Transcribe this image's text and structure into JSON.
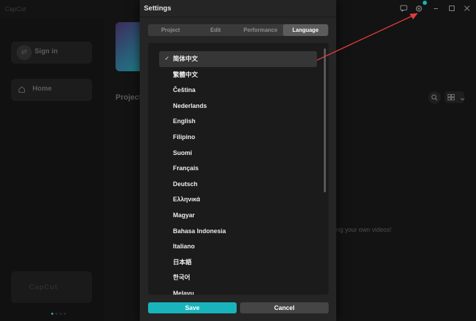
{
  "app": {
    "logo_text": "CapCut",
    "sidebar": {
      "sign_in_label": "Sign in",
      "home_label": "Home",
      "promo_text": "CapCut"
    },
    "main": {
      "projects_title": "Projects",
      "empty_hint": "ng your own videos!"
    }
  },
  "window_controls": [
    "feedback-icon",
    "settings-icon",
    "minimize-icon",
    "maximize-icon",
    "close-icon"
  ],
  "settings": {
    "title": "Settings",
    "tabs": [
      {
        "label": "Project"
      },
      {
        "label": "Edit"
      },
      {
        "label": "Performance"
      },
      {
        "label": "Language",
        "active": true
      }
    ],
    "languages": [
      {
        "label": "简体中文",
        "selected": true
      },
      {
        "label": "繁體中文"
      },
      {
        "label": "Čeština"
      },
      {
        "label": "Nederlands"
      },
      {
        "label": "English"
      },
      {
        "label": "Filipino"
      },
      {
        "label": "Suomi"
      },
      {
        "label": "Français"
      },
      {
        "label": "Deutsch"
      },
      {
        "label": "Ελληνικά"
      },
      {
        "label": "Magyar"
      },
      {
        "label": "Bahasa Indonesia"
      },
      {
        "label": "Italiano"
      },
      {
        "label": "日本語"
      },
      {
        "label": "한국어"
      },
      {
        "label": "Melayu"
      }
    ],
    "check_mark": "✓",
    "save_label": "Save",
    "cancel_label": "Cancel"
  },
  "colors": {
    "accent": "#19b4bb",
    "annotation_arrow": "#e03c3c"
  }
}
